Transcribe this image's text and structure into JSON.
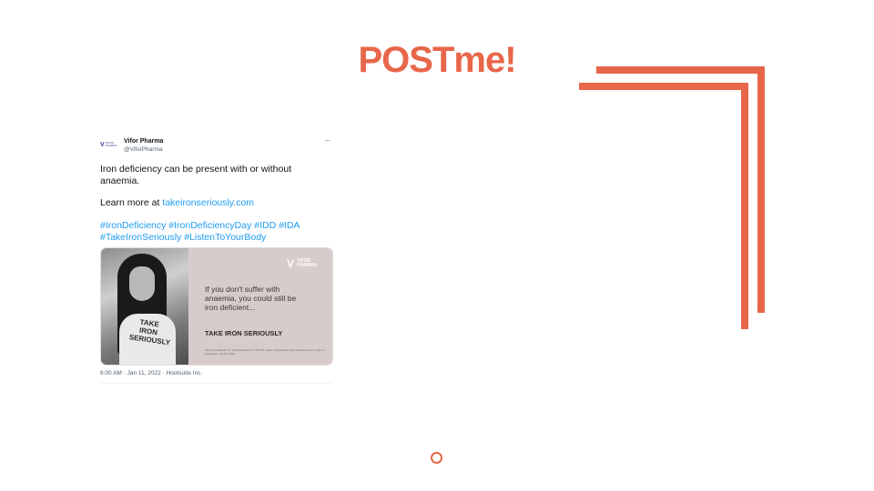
{
  "slide": {
    "title": "POSTme!",
    "accent_color": "#e8664a"
  },
  "tweet": {
    "account_name": "Vifor Pharma",
    "handle": "@ViforPharma",
    "logo_mark": "V",
    "logo_word_1": "VIFOR",
    "logo_word_2": "PHARMA",
    "more_icon": "···",
    "text_line_1": "Iron deficiency can be present with or without",
    "text_line_2": "anaemia.",
    "learn_more_prefix": "Learn more at ",
    "learn_more_link": "takeironseriously.com",
    "hashtags_line_1": "#IronDeficiency #IronDeficiencyDay #IDD #IDA",
    "hashtags_line_2": "#TakeIronSeriously #ListenToYourBody",
    "meta": "8:00 AM · Jan 11, 2022 · Hootsuite Inc.",
    "link_color": "#1d9bf0"
  },
  "media_card": {
    "brand_mark": "V",
    "brand_word_1": "VIFOR",
    "brand_word_2": "PHARMA",
    "shirt_text": "TAKE IRON SERIOUSLY",
    "headline_line_1": "If you don't suffer with",
    "headline_line_2": "anaemia, you could still be",
    "headline_line_3": "iron deficient...",
    "cta": "TAKE IRON SERIOUSLY",
    "fine_print": "Vifor (International) Inc. | Rechenstrasse 37, 9014 St. Gallen, Switzerland | www.viforpharma.com | Date of preparation: January 2022"
  }
}
